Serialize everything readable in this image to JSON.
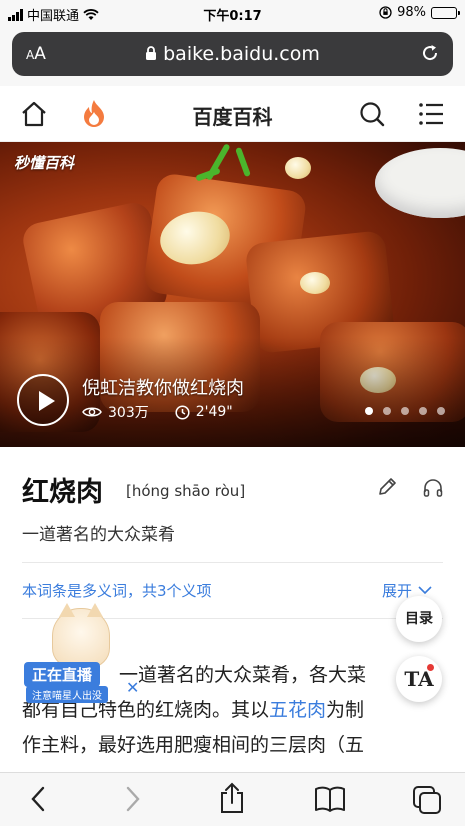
{
  "status_bar": {
    "carrier": "中国联通",
    "time": "下午0:17",
    "battery": "98%",
    "battery_level": 0.98
  },
  "address_bar": {
    "text_size_label": "AA",
    "url": "baike.baidu.com",
    "lock_icon": "lock-icon",
    "reload_icon": "reload-icon"
  },
  "header": {
    "title": "百度百科",
    "home_icon": "home-icon",
    "hot_icon": "flame-icon",
    "search_icon": "search-icon",
    "menu_icon": "menu-icon"
  },
  "video": {
    "brand": "秒懂百科",
    "title": "倪虹洁教你做红烧肉",
    "views": "303万",
    "duration": "2'49\"",
    "slide_count": 5,
    "active_slide": 1
  },
  "entry": {
    "title": "红烧肉",
    "pinyin": "[hóng shāo ròu]",
    "summary": "一道著名的大众菜肴",
    "polysemy_note": "本词条是多义词，共3个义项",
    "expand_label": "展开"
  },
  "body": {
    "line1_prefix": "红",
    "line1_rest": "一道著名的大众菜肴，各大菜",
    "line2_before": "都有自己特色的红烧肉。其以",
    "line2_link": "五花肉",
    "line2_after": "为制",
    "line3": "作主料，最好选用肥瘦相间的三层肉（五"
  },
  "floating": {
    "toc_label": "目录",
    "ta_label": "TA"
  },
  "live_badge": {
    "label": "正在直播",
    "sub_label": "注意喵星人出没"
  },
  "colors": {
    "link_blue": "#3b7ddd",
    "url_bar": "#3a3a3c",
    "notification_red": "#e53935"
  }
}
